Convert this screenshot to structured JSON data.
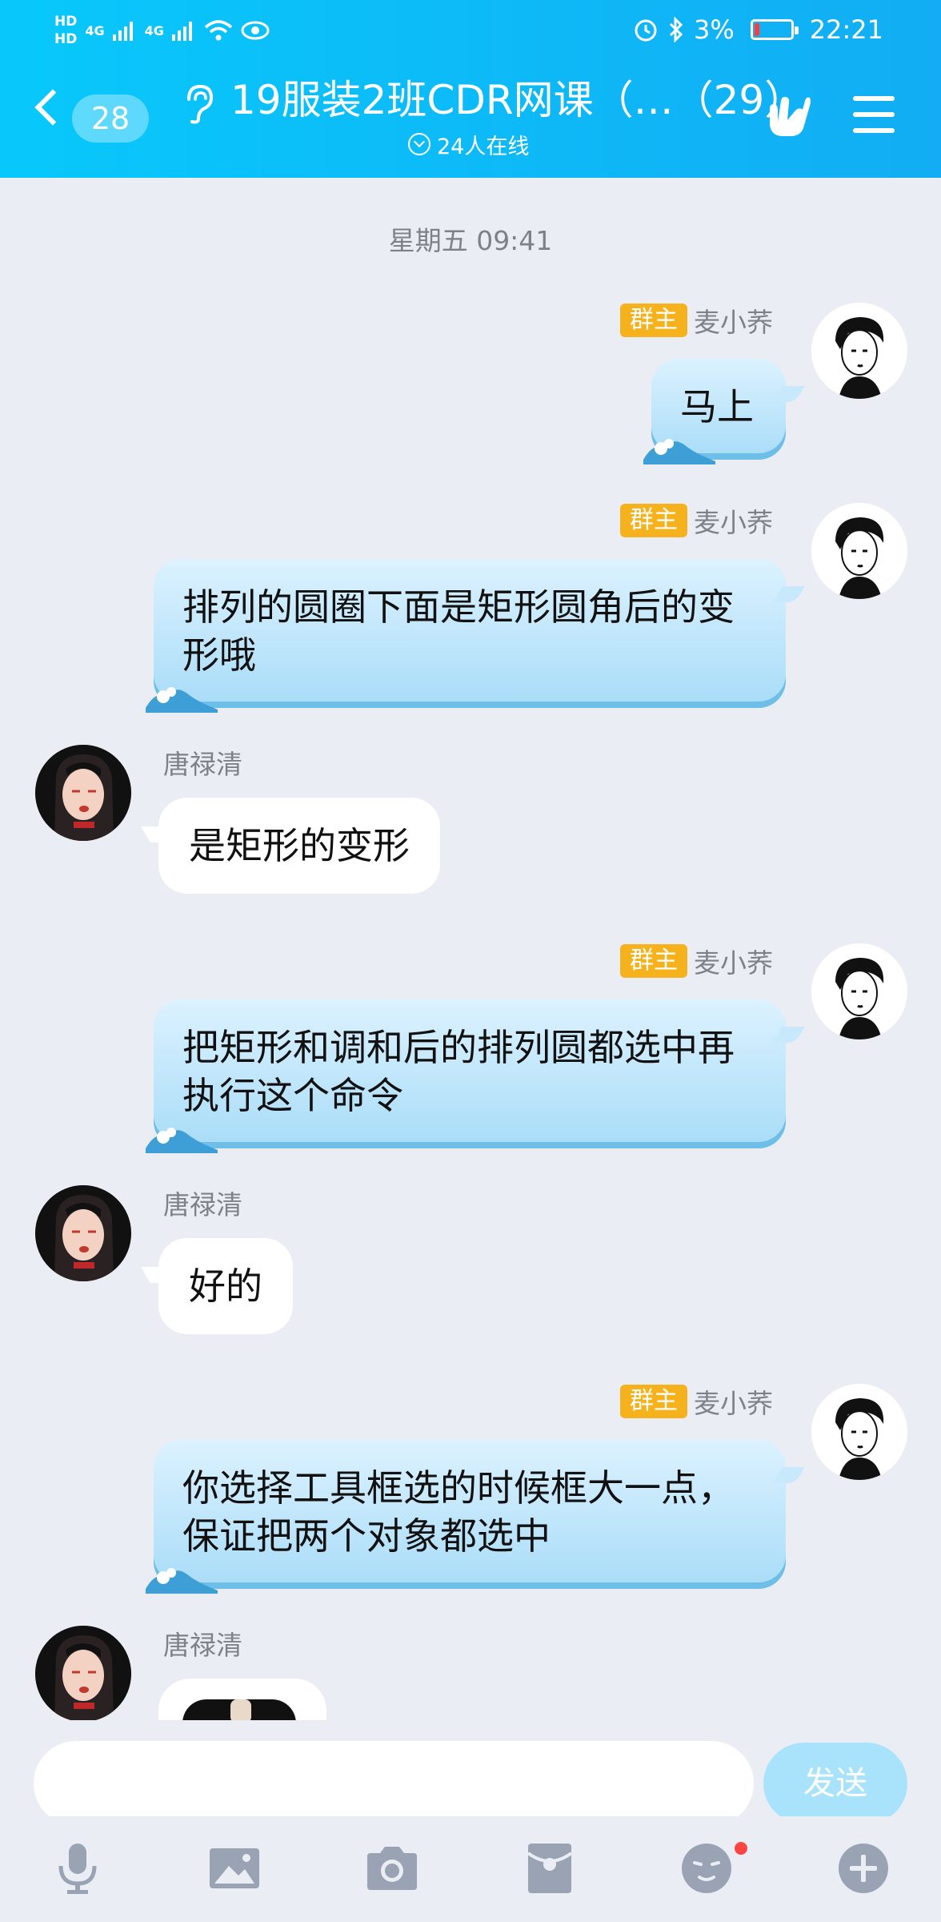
{
  "status_bar": {
    "hd1": "HD",
    "hd2": "HD",
    "net1": "4G",
    "net2": "4G",
    "battery_pct": "3%",
    "time": "22:21",
    "battery_color": "#ff3b3b"
  },
  "header": {
    "unread_count": "28",
    "title": "19服装2班CDR网课（…（29）",
    "online": "24人在线",
    "gradient_start": "#08c8fb",
    "gradient_end": "#12adf4"
  },
  "chat": {
    "timestamp": "星期五 09:41",
    "messages": [
      {
        "side": "right",
        "role": "群主",
        "sender": "麦小荞",
        "text": "马上"
      },
      {
        "side": "right",
        "role": "群主",
        "sender": "麦小荞",
        "text": "排列的圆圈下面是矩形圆角后的变形哦"
      },
      {
        "side": "left",
        "sender": "唐禄清",
        "text": "是矩形的变形"
      },
      {
        "side": "right",
        "role": "群主",
        "sender": "麦小荞",
        "text": "把矩形和调和后的排列圆都选中再执行这个命令"
      },
      {
        "side": "left",
        "sender": "唐禄清",
        "text": "好的"
      },
      {
        "side": "right",
        "role": "群主",
        "sender": "麦小荞",
        "text": "你选择工具框选的时候框大一点，保证把两个对象都选中"
      },
      {
        "side": "left",
        "sender": "唐禄清",
        "text": "",
        "kind": "image"
      }
    ]
  },
  "input": {
    "placeholder": "",
    "send_label": "发送"
  },
  "toolbar": {
    "items": [
      "microphone-icon",
      "image-icon",
      "camera-icon",
      "red-packet-icon",
      "emoji-icon",
      "plus-icon"
    ],
    "notification_color": "#fb4545"
  }
}
